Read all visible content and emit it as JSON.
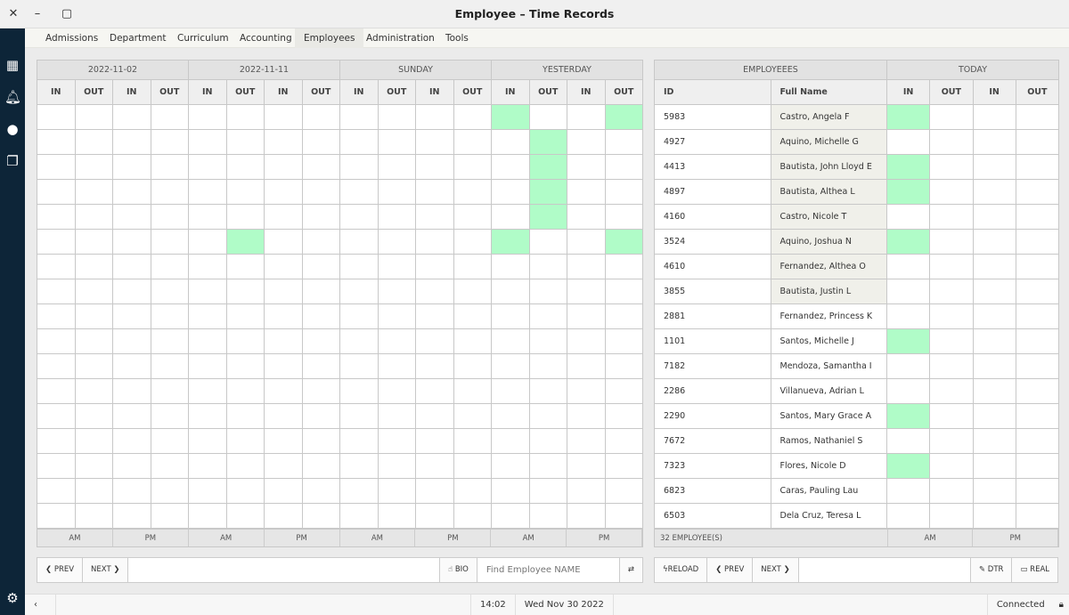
{
  "window": {
    "title": "Employee – Time Records"
  },
  "menu": [
    "Admissions",
    "Department",
    "Curriculum",
    "Accounting",
    "Employees",
    "Administration",
    "Tools"
  ],
  "menu_active": "Employees",
  "left": {
    "groups": [
      "2022-11-02",
      "2022-11-11",
      "SUNDAY",
      "YESTERDAY"
    ],
    "subcols": [
      "IN",
      "OUT",
      "IN",
      "OUT"
    ],
    "footer": [
      "AM",
      "PM",
      "AM",
      "PM",
      "AM",
      "PM",
      "AM",
      "PM"
    ],
    "highlighted_cells": [
      [
        0,
        12
      ],
      [
        0,
        15
      ],
      [
        1,
        13
      ],
      [
        2,
        13
      ],
      [
        3,
        13
      ],
      [
        4,
        13
      ],
      [
        5,
        5
      ],
      [
        5,
        12
      ],
      [
        5,
        15
      ]
    ]
  },
  "right": {
    "groups": [
      "EMPLOYEEES",
      "TODAY"
    ],
    "headers": [
      "ID",
      "Full Name",
      "IN",
      "OUT",
      "IN",
      "OUT"
    ],
    "rows": [
      {
        "id": "5983",
        "name": "Castro, Angela F",
        "in_am": true,
        "shaded": true
      },
      {
        "id": "4927",
        "name": "Aquino, Michelle G",
        "in_am": false,
        "shaded": true
      },
      {
        "id": "4413",
        "name": "Bautista, John Lloyd E",
        "in_am": true,
        "shaded": true
      },
      {
        "id": "4897",
        "name": "Bautista, Althea L",
        "in_am": true,
        "shaded": true
      },
      {
        "id": "4160",
        "name": "Castro, Nicole T",
        "in_am": false,
        "shaded": true
      },
      {
        "id": "3524",
        "name": "Aquino, Joshua N",
        "in_am": true,
        "shaded": true
      },
      {
        "id": "4610",
        "name": "Fernandez, Althea O",
        "in_am": false,
        "shaded": true
      },
      {
        "id": "3855",
        "name": "Bautista, Justin L",
        "in_am": false,
        "shaded": true
      },
      {
        "id": "2881",
        "name": "Fernandez, Princess K",
        "in_am": false,
        "shaded": false
      },
      {
        "id": "1101",
        "name": "Santos, Michelle J",
        "in_am": true,
        "shaded": false
      },
      {
        "id": "7182",
        "name": "Mendoza, Samantha I",
        "in_am": false,
        "shaded": false
      },
      {
        "id": "2286",
        "name": "Villanueva, Adrian L",
        "in_am": false,
        "shaded": false
      },
      {
        "id": "2290",
        "name": "Santos, Mary Grace A",
        "in_am": true,
        "shaded": false
      },
      {
        "id": "7672",
        "name": "Ramos, Nathaniel S",
        "in_am": false,
        "shaded": false
      },
      {
        "id": "7323",
        "name": "Flores, Nicole D",
        "in_am": true,
        "shaded": false
      },
      {
        "id": "6823",
        "name": "Caras, Pauling Lau",
        "in_am": false,
        "shaded": false
      },
      {
        "id": "6503",
        "name": "Dela Cruz, Teresa L",
        "in_am": false,
        "shaded": false
      }
    ],
    "footer": {
      "count": "32 EMPLOYEE(S)",
      "am": "AM",
      "pm": "PM"
    }
  },
  "toolbar_left": {
    "prev": "❮ PREV",
    "next": "NEXT ❯",
    "bio": "BIO",
    "search_placeholder": "Find Employee NAME",
    "search_value": ""
  },
  "toolbar_right": {
    "reload": "RELOAD",
    "prev": "❮ PREV",
    "next": "NEXT ❯",
    "dtr": "DTR",
    "real": "REAL"
  },
  "status": {
    "time": "14:02",
    "date": "Wed Nov 30 2022",
    "connection": "Connected"
  },
  "colors": {
    "present": "#b0fcc8",
    "sidebar": "#0d2538"
  }
}
